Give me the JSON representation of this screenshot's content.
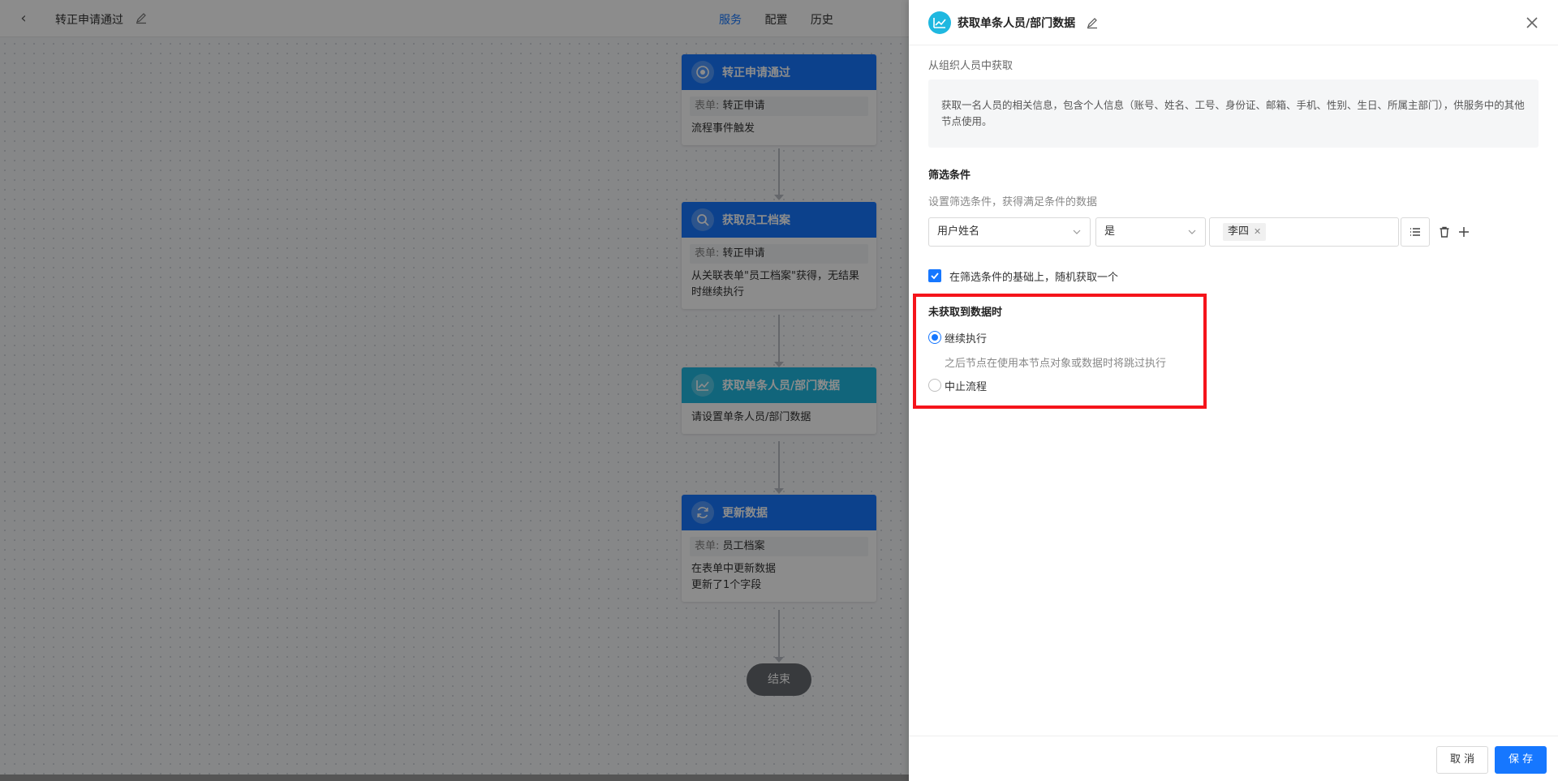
{
  "flow": {
    "title": "转正申请通过",
    "tabs": [
      "服务",
      "配置",
      "历史"
    ],
    "active_tab": 0,
    "nodes": [
      {
        "title": "转正申请通过",
        "field_label": "表单:",
        "field_value": "转正申请",
        "lines": [
          "流程事件触发"
        ]
      },
      {
        "title": "获取员工档案",
        "field_label": "表单:",
        "field_value": "转正申请",
        "lines": [
          "从关联表单\"员工档案\"获得，无结果时继续执行"
        ]
      },
      {
        "title": "获取单条人员/部门数据",
        "lines": [
          "请设置单条人员/部门数据"
        ]
      },
      {
        "title": "更新数据",
        "field_label": "表单:",
        "field_value": "员工档案",
        "lines": [
          "在表单中更新数据",
          "更新了1个字段"
        ]
      }
    ],
    "end_label": "结束"
  },
  "drawer": {
    "title": "获取单条人员/部门数据",
    "subtitle": "从组织人员中获取",
    "description": "获取一名人员的相关信息，包含个人信息（账号、姓名、工号、身份证、邮箱、手机、性别、生日、所属主部门），供服务中的其他节点使用。",
    "filter": {
      "label": "筛选条件",
      "hint": "设置筛选条件，获得满足条件的数据",
      "field": "用户姓名",
      "operator": "是",
      "value_tag": "李四"
    },
    "random_checkbox": {
      "label": "在筛选条件的基础上，随机获取一个",
      "checked": true
    },
    "no_data": {
      "label": "未获取到数据时",
      "options": [
        {
          "label": "继续执行",
          "checked": true,
          "hint": "之后节点在使用本节点对象或数据时将跳过执行"
        },
        {
          "label": "中止流程",
          "checked": false
        }
      ]
    },
    "buttons": {
      "cancel": "取 消",
      "save": "保 存"
    }
  },
  "colors": {
    "primary": "#1677ff",
    "cyan": "#1fb8e0",
    "highlight": "#f5141b"
  }
}
